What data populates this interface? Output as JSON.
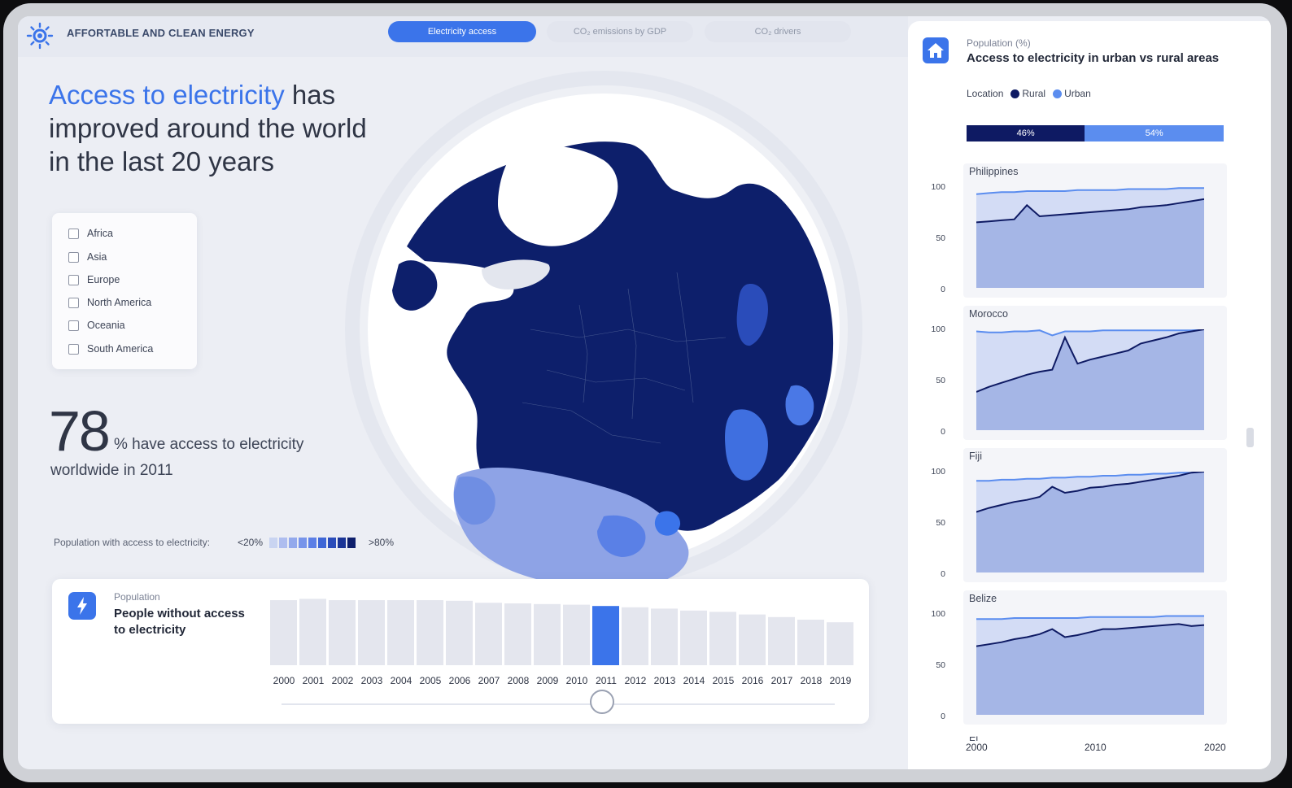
{
  "app": {
    "brand": "AFFORTABLE AND CLEAN ENERGY",
    "tabs": [
      {
        "label": "Electricity access",
        "active": true
      },
      {
        "label": "CO₂ emissions by GDP",
        "active": false
      },
      {
        "label": "CO₂ drivers",
        "active": false
      }
    ]
  },
  "headline": {
    "highlight": "Access to electricity",
    "rest": " has improved around the world in the last 20 years"
  },
  "filters": [
    "Africa",
    "Asia",
    "Europe",
    "North America",
    "Oceania",
    "South America"
  ],
  "stat": {
    "value": "78",
    "text": "% have access to electricity",
    "subtext": "worldwide in 2011"
  },
  "map_legend": {
    "label": "Population with access to electricity:",
    "min": "<20%",
    "max": ">80%",
    "colors": [
      "#c9d4f1",
      "#aebdef",
      "#93a9ec",
      "#7794ea",
      "#5c7fe6",
      "#3e66d6",
      "#2a4cba",
      "#1b3596",
      "#0e1f6c"
    ]
  },
  "bottom_card": {
    "sub": "Population",
    "title": "People without access to electricity",
    "years": [
      "2000",
      "2001",
      "2002",
      "2003",
      "2004",
      "2005",
      "2006",
      "2007",
      "2008",
      "2009",
      "2010",
      "2011",
      "2012",
      "2013",
      "2014",
      "2015",
      "2016",
      "2017",
      "2018",
      "2019"
    ],
    "values": [
      1.0,
      1.02,
      1.0,
      1.0,
      1.0,
      1.0,
      0.99,
      0.96,
      0.95,
      0.94,
      0.93,
      0.91,
      0.89,
      0.87,
      0.84,
      0.82,
      0.78,
      0.74,
      0.7,
      0.66
    ],
    "selected_year": "2011",
    "slider_position": 0.58
  },
  "right_panel": {
    "sub": "Population (%)",
    "title": "Access to electricity in urban vs rural areas",
    "location_label": "Location",
    "series": [
      {
        "name": "Rural",
        "color": "#0e1a63"
      },
      {
        "name": "Urban",
        "color": "#5b8def"
      }
    ],
    "split": [
      {
        "label": "46%",
        "value": 46,
        "color": "#0e1a63"
      },
      {
        "label": "54%",
        "value": 54,
        "color": "#5b8def"
      }
    ],
    "y_ticks": [
      "100",
      "50",
      "0"
    ],
    "x_ticks": [
      "2000",
      "2010",
      "2020"
    ],
    "countries": [
      {
        "name": "Philippines",
        "urban": [
          93,
          94,
          95,
          95,
          96,
          96,
          96,
          96,
          97,
          97,
          97,
          97,
          98,
          98,
          98,
          98,
          99,
          99,
          99
        ],
        "rural": [
          65,
          66,
          67,
          68,
          82,
          71,
          72,
          73,
          74,
          75,
          76,
          77,
          78,
          80,
          81,
          82,
          84,
          86,
          88
        ]
      },
      {
        "name": "Morocco",
        "urban": [
          98,
          97,
          97,
          98,
          98,
          99,
          94,
          98,
          98,
          98,
          99,
          99,
          99,
          99,
          99,
          99,
          99,
          99,
          100
        ],
        "rural": [
          38,
          43,
          47,
          51,
          55,
          58,
          60,
          92,
          66,
          70,
          73,
          76,
          79,
          86,
          89,
          92,
          96,
          98,
          100
        ]
      },
      {
        "name": "Fiji",
        "urban": [
          91,
          91,
          92,
          92,
          93,
          93,
          94,
          94,
          95,
          95,
          96,
          96,
          97,
          97,
          98,
          98,
          99,
          99,
          100
        ],
        "rural": [
          60,
          64,
          67,
          70,
          72,
          75,
          85,
          79,
          81,
          84,
          85,
          87,
          88,
          90,
          92,
          94,
          96,
          99,
          100
        ]
      },
      {
        "name": "Belize",
        "urban": [
          95,
          95,
          95,
          96,
          96,
          96,
          96,
          96,
          96,
          97,
          97,
          97,
          97,
          97,
          97,
          98,
          98,
          98,
          98
        ],
        "rural": [
          68,
          70,
          72,
          75,
          77,
          80,
          85,
          77,
          79,
          82,
          85,
          85,
          86,
          87,
          88,
          89,
          90,
          88,
          89
        ]
      }
    ],
    "next_country": "El Salvador"
  }
}
